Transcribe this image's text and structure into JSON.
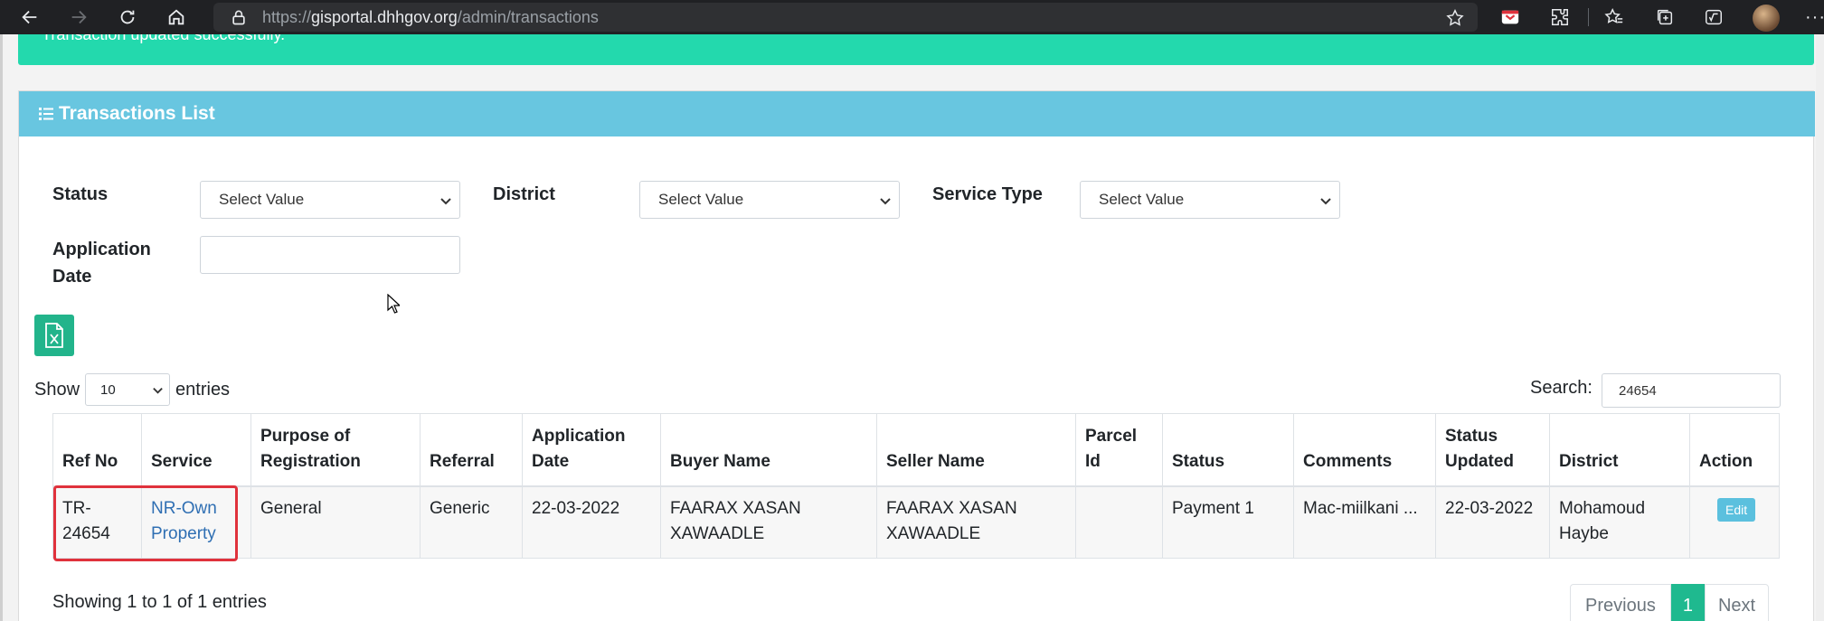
{
  "browser": {
    "url_scheme": "https://",
    "url_host": "gisportal.dhhgov.org",
    "url_path": "/admin/transactions",
    "more": "···"
  },
  "alert": {
    "text": "Transaction updated successfully."
  },
  "card": {
    "title": "Transactions List"
  },
  "filters": {
    "status_label": "Status",
    "status_value": "Select Value",
    "district_label": "District",
    "district_value": "Select Value",
    "service_type_label": "Service Type",
    "service_type_value": "Select Value",
    "application_date_label_line1": "Application",
    "application_date_label_line2": "Date",
    "application_date_value": ""
  },
  "entries": {
    "show_label": "Show",
    "count": "10",
    "entries_label": "entries"
  },
  "search": {
    "label": "Search:",
    "value": "24654"
  },
  "table": {
    "headers": [
      [
        "Ref No"
      ],
      [
        "Service"
      ],
      [
        "Purpose of",
        "Registration"
      ],
      [
        "Referral"
      ],
      [
        "Application",
        "Date"
      ],
      [
        "Buyer Name"
      ],
      [
        "Seller Name"
      ],
      [
        "Parcel",
        "Id"
      ],
      [
        "Status"
      ],
      [
        "Comments"
      ],
      [
        "Status",
        "Updated"
      ],
      [
        "District"
      ],
      [
        "Action"
      ]
    ],
    "rows": [
      {
        "ref_no_1": "TR-",
        "ref_no_2": "24654",
        "service_1": "NR-Own",
        "service_2": "Property",
        "purpose": "General",
        "referral": "Generic",
        "application_date": "22-03-2022",
        "buyer_1": "FAARAX XASAN",
        "buyer_2": "XAWAADLE",
        "seller_1": "FAARAX XASAN",
        "seller_2": "XAWAADLE",
        "parcel_id": "",
        "status": "Payment 1",
        "comments": "Mac-miilkani ...",
        "status_updated": "22-03-2022",
        "district_1": "Mohamoud",
        "district_2": "Haybe",
        "action": "Edit"
      }
    ]
  },
  "footer": {
    "showing": "Showing 1 to 1 of 1 entries",
    "previous": "Previous",
    "page": "1",
    "next": "Next"
  },
  "colors": {
    "alert_bg": "#23d9ad",
    "header_bg": "#68c6e0",
    "excel_btn": "#22b48b",
    "active_page": "#1fb98f",
    "highlight": "#e0323c"
  }
}
